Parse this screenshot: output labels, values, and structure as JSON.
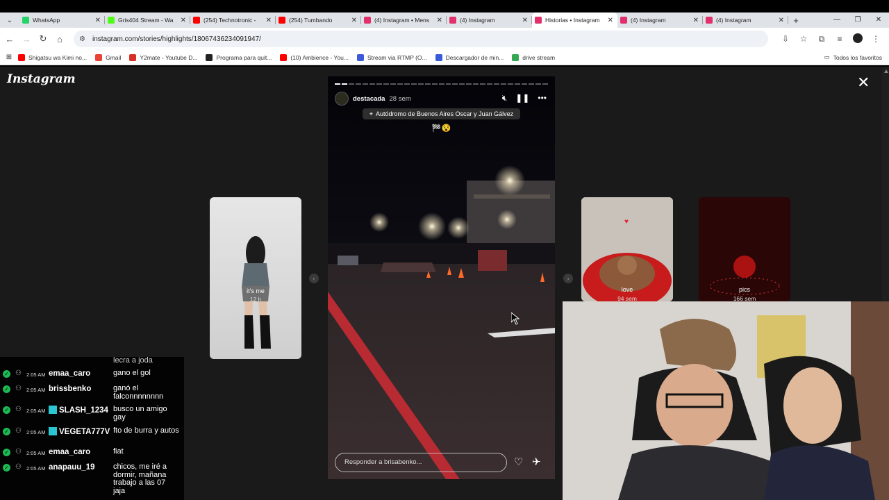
{
  "browser": {
    "tabs": [
      {
        "label": "WhatsApp",
        "color": "#25d366",
        "active": false
      },
      {
        "label": "Gris404 Stream - Wa",
        "color": "#53fc18",
        "active": false
      },
      {
        "label": "(254) Technotronic -",
        "color": "#ff0000",
        "active": false
      },
      {
        "label": "(254) Tumbando",
        "color": "#ff0000",
        "active": false
      },
      {
        "label": "(4) Instagram • Mens",
        "color": "#e1306c",
        "active": false
      },
      {
        "label": "(4) Instagram",
        "color": "#e1306c",
        "active": false
      },
      {
        "label": "Historias • Instagram",
        "color": "#e1306c",
        "active": true
      },
      {
        "label": "(4) Instagram",
        "color": "#e1306c",
        "active": false
      },
      {
        "label": "(4) Instagram",
        "color": "#e1306c",
        "active": false
      }
    ],
    "url": "instagram.com/stories/highlights/18067436234091947/",
    "bookmarks": [
      {
        "label": "Shigatsu wa Kimi no...",
        "color": "#ff0000"
      },
      {
        "label": "Gmail",
        "color": "#ea4335"
      },
      {
        "label": "Y2mate - Youtube D...",
        "color": "#d93025"
      },
      {
        "label": "Programa para quit...",
        "color": "#222222"
      },
      {
        "label": "(10) Ambience - You...",
        "color": "#ff0000"
      },
      {
        "label": "Stream via RTMP (O...",
        "color": "#3b5bdb"
      },
      {
        "label": "Descargador de min...",
        "color": "#3a5bd9"
      },
      {
        "label": "drive stream",
        "color": "#34a853"
      }
    ],
    "all_bookmarks": "Todos los favoritos"
  },
  "instagram": {
    "logo": "Instagram",
    "story": {
      "username": "destacada",
      "time": "28 sem",
      "location": "Autódromo de Buenos Aires Oscar y Juan Gálvez",
      "emoji": "🏁😵",
      "reply_placeholder": "Responder a brisabenko...",
      "progress_done": 2,
      "progress_total": 31
    },
    "left_story": {
      "name": "it's me",
      "time": "12 h"
    },
    "right_stories": [
      {
        "name": "love",
        "time": "94 sem"
      },
      {
        "name": "pics",
        "time": "166 sem"
      }
    ]
  },
  "chat": {
    "partial": "lecra a joda",
    "messages": [
      {
        "time": "2:05 AM",
        "user": "emaa_caro",
        "text": "gano el gol",
        "badge": false
      },
      {
        "time": "2:05 AM",
        "user": "brissbenko",
        "text": "ganó el falconnnnnnnn",
        "badge": false
      },
      {
        "time": "2:05 AM",
        "user": "SLASH_1234",
        "text": "busco un amigo gay",
        "badge": true
      },
      {
        "time": "2:05 AM",
        "user": "VEGETA777V",
        "text": "fto de burra y autos",
        "badge": true
      },
      {
        "time": "2:05 AM",
        "user": "emaa_caro",
        "text": "fiat",
        "badge": false
      },
      {
        "time": "2:05 AM",
        "user": "anapauu_19",
        "text": "chicos, me iré a dormir, mañana trabajo a las 07 jaja",
        "badge": false
      }
    ]
  }
}
